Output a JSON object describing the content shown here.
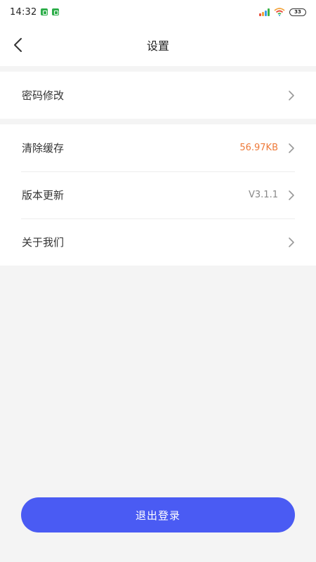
{
  "status_bar": {
    "time": "14:32",
    "battery": "33",
    "notification_icons": [
      "app-notification-icon",
      "app-notification-icon"
    ]
  },
  "navbar": {
    "title": "设置",
    "back_icon": "chevron-left-icon"
  },
  "settings": {
    "password": {
      "label": "密码修改"
    },
    "clear_cache": {
      "label": "清除缓存",
      "value": "56.97KB",
      "value_color": "#ee7a3a"
    },
    "version": {
      "label": "版本更新",
      "value": "V3.1.1"
    },
    "about": {
      "label": "关于我们"
    }
  },
  "logout": {
    "label": "退出登录",
    "color": "#4a5bf3"
  }
}
